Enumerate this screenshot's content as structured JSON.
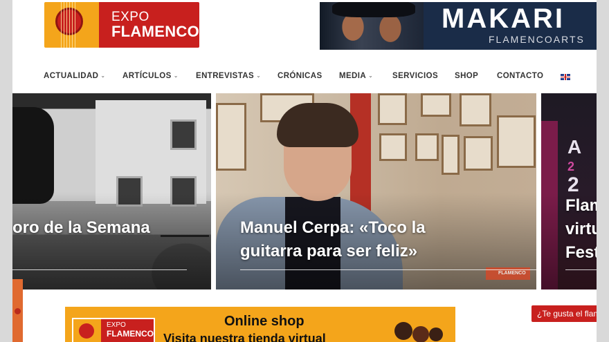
{
  "header": {
    "logo": {
      "line1": "EXPO",
      "line2": "FLAMENCO"
    },
    "banner": {
      "title": "MAKARI",
      "subtitle": "FLAMENCOARTS"
    }
  },
  "nav": {
    "items": [
      {
        "label": "ACTUALIDAD",
        "dropdown": true
      },
      {
        "label": "ARTÍCULOS",
        "dropdown": true
      },
      {
        "label": "ENTREVISTAS",
        "dropdown": true
      },
      {
        "label": "CRÓNICAS",
        "dropdown": false
      },
      {
        "label": "MEDIA",
        "dropdown": true
      },
      {
        "label": "SERVICIOS",
        "dropdown": false
      },
      {
        "label": "SHOP",
        "dropdown": false
      },
      {
        "label": "CONTACTO",
        "dropdown": false
      }
    ],
    "chevron": "⌄",
    "language_icon": "uk-flag-icon"
  },
  "slider": {
    "slides": [
      {
        "title": "oro de la Semana"
      },
      {
        "title_line1": "Manuel Cerpa: «Toco la",
        "title_line2": "guitarra para ser feliz»",
        "watermark": "FLAMENCO"
      },
      {
        "title_line1": "Flam",
        "title_line2": "virtu",
        "title_line3": "Festi",
        "big1": "A",
        "big2": "2",
        "big3": "2"
      }
    ]
  },
  "shop_banner": {
    "logo_line1": "EXPO",
    "logo_line2": "FLAMENCO",
    "title": "Online shop",
    "subtitle": "Visita nuestra tienda virtual"
  },
  "like_button": {
    "label": "¿Te gusta el flam"
  },
  "colors": {
    "brand_red": "#c8201e",
    "brand_orange": "#f4a51b"
  }
}
